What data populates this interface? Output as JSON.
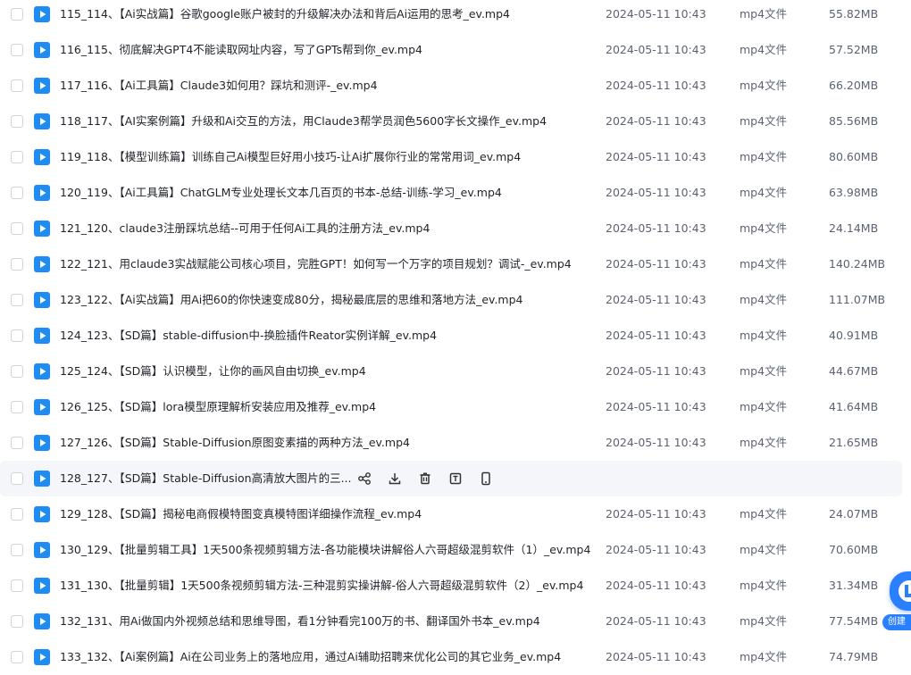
{
  "files": [
    {
      "name": "115_114、【Ai实战篇】谷歌google账户被封的升级解决办法和背后Ai运用的思考_ev.mp4",
      "date": "2024-05-11 10:43",
      "type": "mp4文件",
      "size": "55.82MB"
    },
    {
      "name": "116_115、彻底解决GPT4不能读取网址内容，写了GPTs帮到你_ev.mp4",
      "date": "2024-05-11 10:43",
      "type": "mp4文件",
      "size": "57.52MB"
    },
    {
      "name": "117_116、【Ai工具篇】Claude3如何用？踩坑和测评-_ev.mp4",
      "date": "2024-05-11 10:43",
      "type": "mp4文件",
      "size": "66.20MB"
    },
    {
      "name": "118_117、【AI实案例篇】升级和Ai交互的方法，用Claude3帮学员润色5600字长文操作_ev.mp4",
      "date": "2024-05-11 10:43",
      "type": "mp4文件",
      "size": "85.56MB"
    },
    {
      "name": "119_118、【模型训练篇】训练自己Ai模型巨好用小技巧-让Ai扩展你行业的常常用词_ev.mp4",
      "date": "2024-05-11 10:43",
      "type": "mp4文件",
      "size": "80.60MB"
    },
    {
      "name": "120_119、【Ai工具篇】ChatGLM专业处理长文本几百页的书本-总结-训练-学习_ev.mp4",
      "date": "2024-05-11 10:43",
      "type": "mp4文件",
      "size": "63.98MB"
    },
    {
      "name": "121_120、claude3注册踩坑总结--可用于任何Ai工具的注册方法_ev.mp4",
      "date": "2024-05-11 10:43",
      "type": "mp4文件",
      "size": "24.14MB"
    },
    {
      "name": "122_121、用claude3实战赋能公司核心项目，完胜GPT！如何写一个万字的项目规划？调试-_ev.mp4",
      "date": "2024-05-11 10:43",
      "type": "mp4文件",
      "size": "140.24MB"
    },
    {
      "name": "123_122、【Ai实战篇】用Ai把60的你快速变成80分，揭秘最底层的思维和落地方法_ev.mp4",
      "date": "2024-05-11 10:43",
      "type": "mp4文件",
      "size": "111.07MB"
    },
    {
      "name": "124_123、【SD篇】stable-diffusion中-换脸插件Reator实例详解_ev.mp4",
      "date": "2024-05-11 10:43",
      "type": "mp4文件",
      "size": "40.91MB"
    },
    {
      "name": "125_124、【SD篇】认识模型，让你的画风自由切换_ev.mp4",
      "date": "2024-05-11 10:43",
      "type": "mp4文件",
      "size": "44.67MB"
    },
    {
      "name": "126_125、【SD篇】lora模型原理解析安装应用及推荐_ev.mp4",
      "date": "2024-05-11 10:43",
      "type": "mp4文件",
      "size": "41.64MB"
    },
    {
      "name": "127_126、【SD篇】Stable-Diffusion原图变素描的两种方法_ev.mp4",
      "date": "2024-05-11 10:43",
      "type": "mp4文件",
      "size": "21.65MB"
    },
    {
      "name": "128_127、【SD篇】Stable-Diffusion高清放大图片的三...",
      "date": "",
      "type": "",
      "size": "",
      "hovered": true
    },
    {
      "name": "129_128、【SD篇】揭秘电商假模特图变真模特图详细操作流程_ev.mp4",
      "date": "2024-05-11 10:43",
      "type": "mp4文件",
      "size": "24.07MB"
    },
    {
      "name": "130_129、【批量剪辑工具】1天500条视频剪辑方法-各功能模块讲解俗人六哥超级混剪软件（1）_ev.mp4",
      "date": "2024-05-11 10:43",
      "type": "mp4文件",
      "size": "70.60MB"
    },
    {
      "name": "131_130、【批量剪辑】1天500条视频剪辑方法-三种混剪实操讲解-俗人六哥超级混剪软件（2）_ev.mp4",
      "date": "2024-05-11 10:43",
      "type": "mp4文件",
      "size": "31.34MB"
    },
    {
      "name": "132_131、用Ai做国内外视频总结和思维导图，看1分钟看完100万的书、翻译国外书本_ev.mp4",
      "date": "2024-05-11 10:43",
      "type": "mp4文件",
      "size": "77.54MB"
    },
    {
      "name": "133_132、【Ai案例篇】Ai在公司业务上的落地应用，通过Ai辅助招聘来优化公司的其它业务_ev.mp4",
      "date": "2024-05-11 10:43",
      "type": "mp4文件",
      "size": "74.79MB"
    }
  ],
  "row_actions": [
    {
      "icon": "share-icon"
    },
    {
      "icon": "download-icon"
    },
    {
      "icon": "trash-icon"
    },
    {
      "icon": "rename-icon"
    },
    {
      "icon": "phone-icon"
    }
  ],
  "float_button": {
    "label": "创建"
  },
  "colors": {
    "accent": "#1e8cf0",
    "hover_bg": "#f5f6fa",
    "text": "#1f2329",
    "muted": "#5c6370"
  }
}
